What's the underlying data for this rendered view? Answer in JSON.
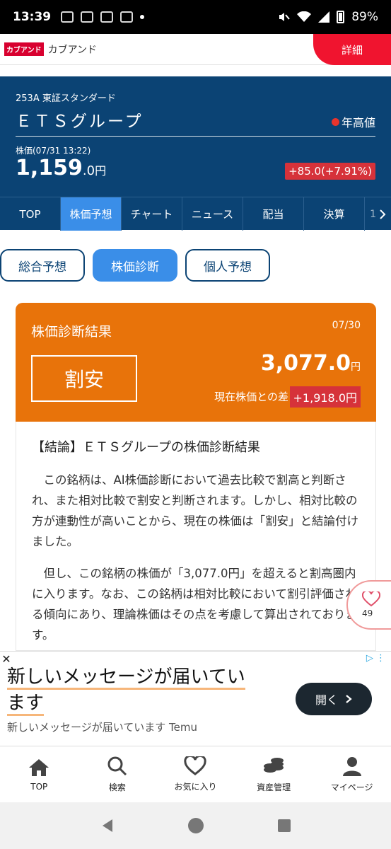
{
  "status_bar": {
    "time": "13:39",
    "battery": "89%"
  },
  "top_ad": {
    "logo": "カブアンド",
    "name": "カブアンド",
    "detail_label": "詳細"
  },
  "stock": {
    "code_market": "253A 東証スタンダード",
    "name": "ＥＴＳグループ",
    "high_badge": "年高値",
    "price_label": "株価(07/31 13:22)",
    "price_int": "1,159",
    "price_dec": ".0",
    "price_unit": "円",
    "change": "+85.0(+7.91%)"
  },
  "tabs": [
    {
      "label": "TOP"
    },
    {
      "label": "株価予想"
    },
    {
      "label": "チャート"
    },
    {
      "label": "ニュース"
    },
    {
      "label": "配当"
    },
    {
      "label": "決算"
    },
    {
      "label": "1"
    }
  ],
  "sub_tabs": [
    {
      "label": "総合予想"
    },
    {
      "label": "株価診断"
    },
    {
      "label": "個人予想"
    }
  ],
  "diagnosis": {
    "title": "株価診断結果",
    "date": "07/30",
    "verdict": "割安",
    "theoretical_price": "3,077.0",
    "price_unit": "円",
    "diff_label": "現在株価との差",
    "diff_value": "+1,918.0円"
  },
  "conclusion": {
    "heading": "【結論】ＥＴＳグループの株価診断結果",
    "paragraph1": "この銘柄は、AI株価診断において過去比較で割高と判断され、また相対比較で割安と判断されます。しかし、相対比較の方が連動性が高いことから、現在の株価は「割安」と結論付けました。",
    "paragraph2": "但し、この銘柄の株価が「3,077.0円」を超えると割高圏内に入ります。なお、この銘柄は相対比較において割引評価される傾向にあり、理論株価はその点を考慮して算出されております。"
  },
  "favorite": {
    "count": "49"
  },
  "bottom_ad": {
    "headline_line1": "新しいメッセージが届いてい",
    "headline_line2": "ます",
    "subline": "新しいメッセージが届いています Temu",
    "open_label": "開く"
  },
  "bottom_nav": [
    {
      "label": "TOP",
      "icon": "home-icon"
    },
    {
      "label": "検索",
      "icon": "search-icon"
    },
    {
      "label": "お気に入り",
      "icon": "heart-icon"
    },
    {
      "label": "資産管理",
      "icon": "coins-icon"
    },
    {
      "label": "マイページ",
      "icon": "person-icon"
    }
  ],
  "colors": {
    "navy": "#0b4374",
    "accent_blue": "#3a8ee8",
    "orange": "#e8730a",
    "red": "#d6323a"
  }
}
